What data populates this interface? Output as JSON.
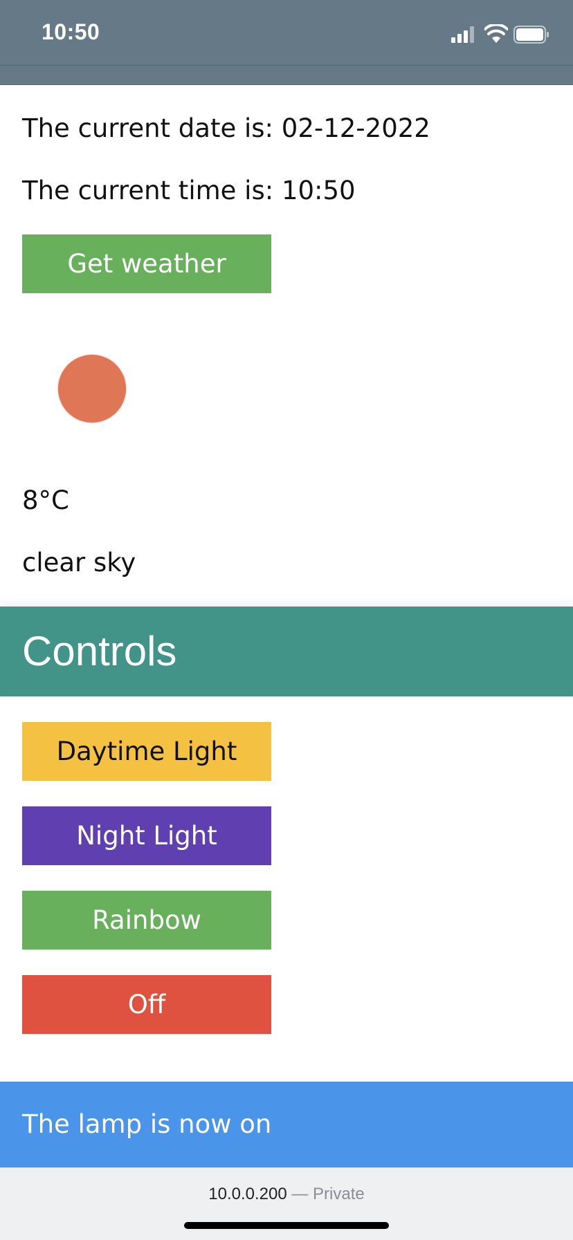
{
  "status_bar": {
    "time": "10:50",
    "icons": [
      "signal-icon",
      "wifi-icon",
      "battery-icon"
    ]
  },
  "info": {
    "date_text": "The current date is: 02-12-2022",
    "time_text": "The current time is: 10:50"
  },
  "weather": {
    "button_label": "Get weather",
    "icon": "weather-sun-icon",
    "temperature": "8°C",
    "description": "clear sky"
  },
  "controls": {
    "title": "Controls",
    "buttons": [
      {
        "label": "Daytime Light",
        "color": "#f4c142",
        "text_color": "#111111"
      },
      {
        "label": "Night Light",
        "color": "#6040b0",
        "text_color": "#ffffff"
      },
      {
        "label": "Rainbow",
        "color": "#68b05c",
        "text_color": "#ffffff"
      },
      {
        "label": "Off",
        "color": "#e05240",
        "text_color": "#ffffff"
      }
    ]
  },
  "status_message": "The lamp is now on",
  "browser": {
    "address": "10.0.0.200",
    "separator": "—",
    "mode": "Private"
  },
  "colors": {
    "status_bar": "#657a86",
    "weather_button": "#68b05c",
    "controls_header": "#439488",
    "lamp_banner": "#4a94ea"
  }
}
